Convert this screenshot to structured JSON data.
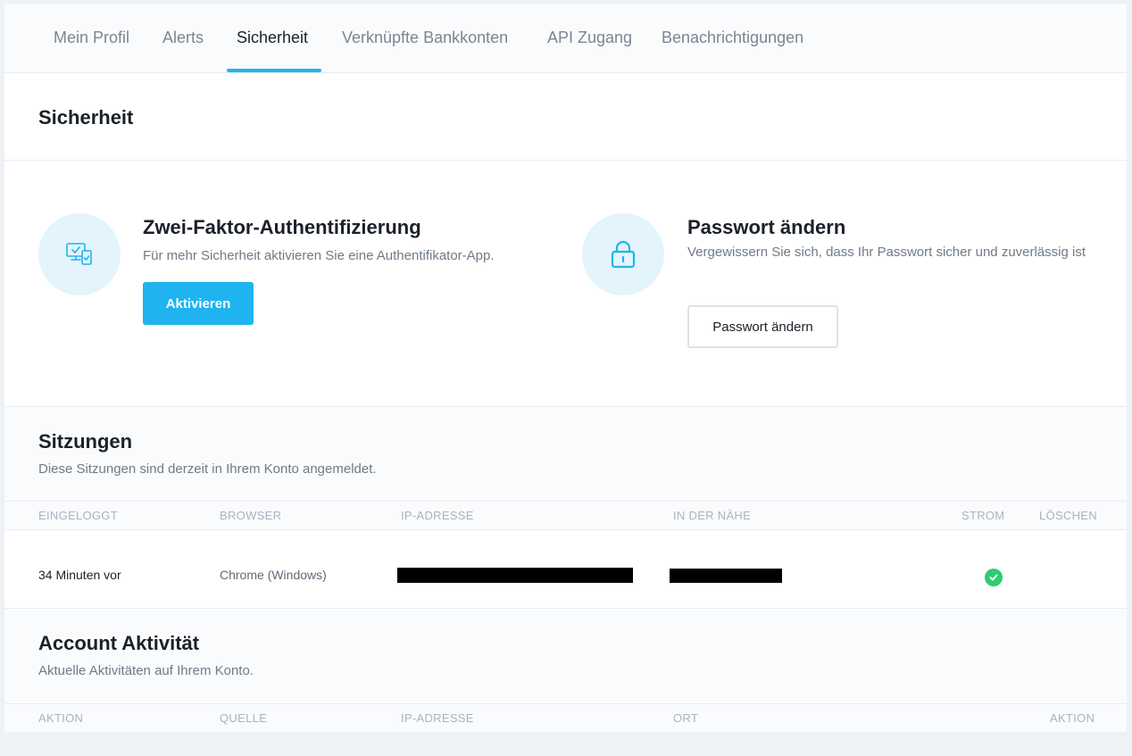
{
  "tabs": [
    {
      "label": "Mein Profil"
    },
    {
      "label": "Alerts"
    },
    {
      "label": "Sicherheit",
      "active": true
    },
    {
      "label": "Verknüpfte Bankkonten"
    },
    {
      "label": "API Zugang"
    },
    {
      "label": "Benachrichtigungen"
    }
  ],
  "security": {
    "title": "Sicherheit",
    "two_factor": {
      "title": "Zwei-Faktor-Authentifizierung",
      "description": "Für mehr Sicherheit aktivieren Sie eine Authentifikator-App.",
      "button": "Aktivieren",
      "icon": "device-check-icon"
    },
    "password": {
      "title": "Passwort ändern",
      "description": "Vergewissern Sie sich, dass Ihr Passwort sicher und zuverlässig ist",
      "button": "Passwort ändern",
      "icon": "lock-icon"
    }
  },
  "sessions": {
    "title": "Sitzungen",
    "subtitle": "Diese Sitzungen sind derzeit in Ihrem Konto angemeldet.",
    "columns": [
      "EINGELOGGT",
      "BROWSER",
      "IP-ADRESSE",
      "IN DER NÄHE",
      "STROM",
      "LÖSCHEN"
    ],
    "rows": [
      {
        "logged_in": "34 Minuten vor",
        "browser": "Chrome (Windows)",
        "ip": "",
        "near": "",
        "current": true
      }
    ]
  },
  "activity": {
    "title": "Account Aktivität",
    "subtitle": "Aktuelle Aktivitäten auf Ihrem Konto.",
    "columns": [
      "AKTION",
      "QUELLE",
      "IP-ADRESSE",
      "ORT",
      "AKTION"
    ]
  },
  "colors": {
    "accent": "#1fb4f0",
    "success": "#2ecc71",
    "icon_bg": "#e3f4fc"
  }
}
